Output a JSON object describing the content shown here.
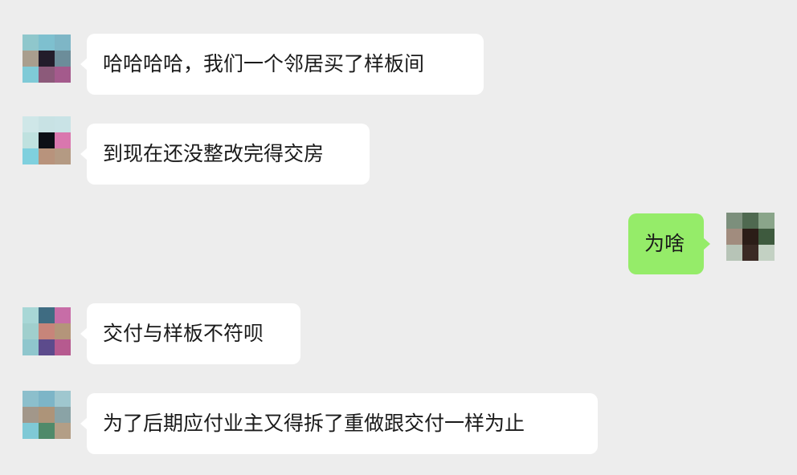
{
  "chat": {
    "messages": [
      {
        "sender": "other",
        "text": "哈哈哈哈，我们一个邻居买了样板间",
        "avatar_colors": [
          "#8fc7cc",
          "#7ec0cf",
          "#7eb6c6",
          "#a99e8e",
          "#231d2b",
          "#6c8d9a",
          "#7fcad7",
          "#8c5a7a",
          "#a45a8c"
        ]
      },
      {
        "sender": "other",
        "text": "到现在还没整改完得交房",
        "avatar_colors": [
          "#cfe7e8",
          "#c8e2e4",
          "#c9e3e6",
          "#bfe1df",
          "#0d0f16",
          "#d977ae",
          "#7fd0de",
          "#b8937c",
          "#b49a83"
        ]
      },
      {
        "sender": "self",
        "text": "为啥",
        "avatar_colors": [
          "#7c8f7c",
          "#4f6950",
          "#8aa58a",
          "#a18c7e",
          "#2b1d17",
          "#3e5a3e",
          "#b7c4b7",
          "#3a2a24",
          "#c3d1c3"
        ]
      },
      {
        "sender": "other",
        "text": "交付与样板不符呗",
        "avatar_colors": [
          "#a8d7d6",
          "#3f6c82",
          "#c76da7",
          "#a0cfcd",
          "#c7857a",
          "#b4957a",
          "#8fc6cd",
          "#5c4b8c",
          "#b65a8f"
        ]
      },
      {
        "sender": "other",
        "text": "为了后期应付业主又得拆了重做跟交付一样为止",
        "avatar_colors": [
          "#8cbfcc",
          "#7db5c7",
          "#9fc7cf",
          "#a2978a",
          "#ad9479",
          "#8aa3a6",
          "#7fc9d6",
          "#4f8a6a",
          "#b39e86"
        ]
      }
    ]
  }
}
